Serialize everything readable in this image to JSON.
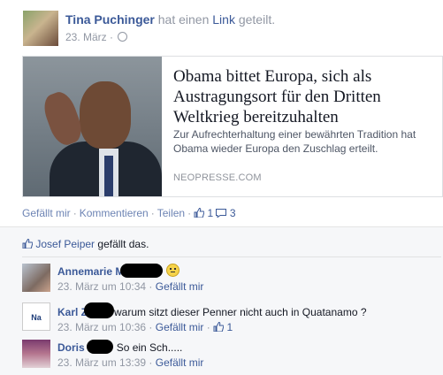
{
  "post": {
    "author": "Tina Puchinger",
    "action_prefix": "hat einen",
    "action_link": "Link",
    "action_suffix": "geteilt.",
    "date": "23. März",
    "meta_sep": "·"
  },
  "card": {
    "title": "Obama bittet Europa, sich als Austragungsort für den Dritten Weltkrieg bereitzuhalten",
    "description": "Zur Aufrechterhaltung einer bewährten Tradition hat Obama wieder Europa den Zuschlag erteilt.",
    "source": "NEOPRESSE.COM"
  },
  "actions": {
    "like": "Gefällt mir",
    "comment": "Kommentieren",
    "share": "Teilen",
    "sep": "·",
    "like_count": "1",
    "comment_count": "3"
  },
  "likes": {
    "who": "Josef Peiper",
    "suffix": "gefällt das."
  },
  "comments": [
    {
      "name": "Annemarie M",
      "text": "",
      "time": "23. März um 10:34",
      "like": "Gefällt mir",
      "like_count": ""
    },
    {
      "name": "Karl Z",
      "text": "warum sitzt dieser Penner nicht auch in Quatanamo ?",
      "time": "23. März um 10:36",
      "like": "Gefällt mir",
      "like_count": "1",
      "avatar_text": "Na und?"
    },
    {
      "name": "Doris I",
      "text": "So ein Sch.....",
      "time": "23. März um 13:39",
      "like": "Gefällt mir",
      "like_count": ""
    }
  ],
  "icons": {
    "globe": "globe-icon",
    "thumbs_up": "thumbs-up-icon",
    "comment_bubble": "comment-bubble-icon",
    "smiley": "smiley-icon"
  },
  "colors": {
    "link_blue": "#3b5998",
    "muted": "#9197a3",
    "feedback_bg": "#f6f7f9"
  }
}
